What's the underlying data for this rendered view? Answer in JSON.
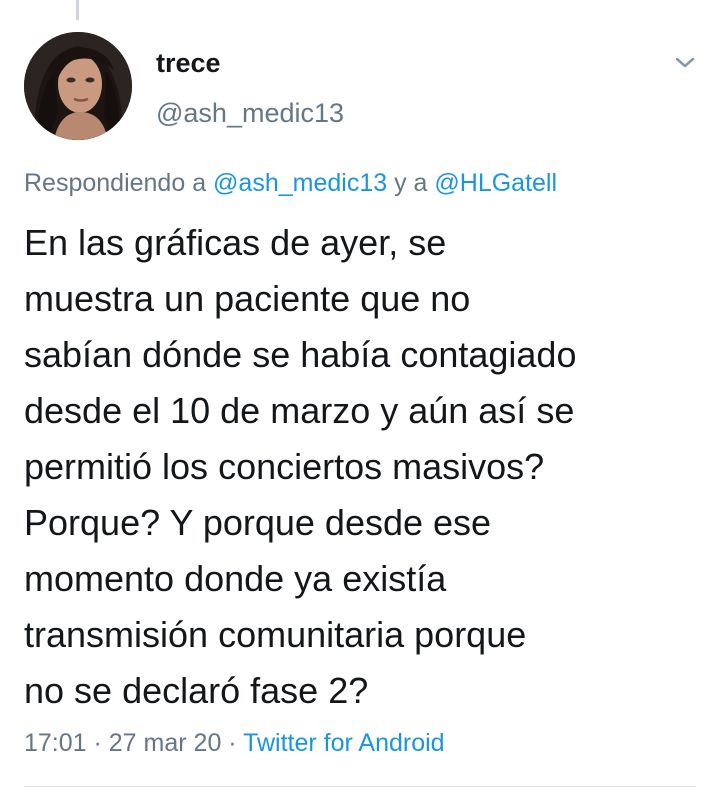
{
  "tweet": {
    "display_name": "trece",
    "handle": "@ash_medic13",
    "reply": {
      "prefix": "Respondiendo a ",
      "mention_1": "@ash_medic13",
      "joiner": " y a ",
      "mention_2": "@HLGatell"
    },
    "text": "En las gráficas de ayer, se\nmuestra un paciente que no\nsabían dónde se había contagiado\ndesde el 10 de marzo y aún así se\npermitió los conciertos masivos?\nPorque? Y porque desde ese\nmomento donde ya existía\ntransmisión comunitaria porque\nno se declaró fase 2?",
    "time": "17:01",
    "separator_1": " · ",
    "date": "27 mar 20",
    "separator_2": " · ",
    "source": "Twitter for Android"
  },
  "icons": {
    "menu": "chevron-down-icon",
    "avatar": "profile-photo"
  },
  "colors": {
    "text": "#14171a",
    "secondary": "#657786",
    "link": "#1b95e0",
    "divider": "#e1e8ed",
    "thread_line": "#ccd6dd"
  }
}
